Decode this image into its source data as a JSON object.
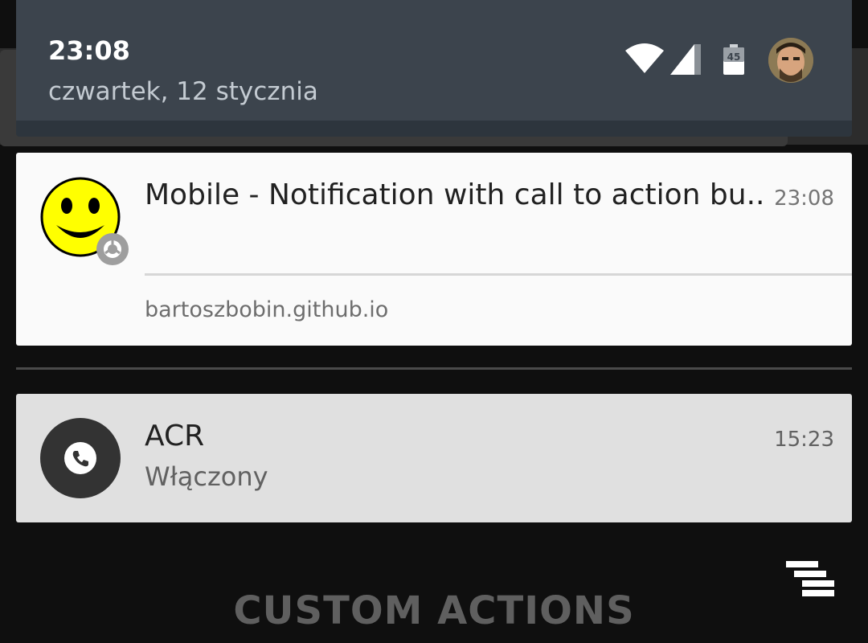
{
  "status_bar": {
    "time": "23:08",
    "date": "czwartek, 12 stycznia",
    "battery_level": "45",
    "icons": [
      "wifi-icon",
      "signal-icon",
      "battery-icon",
      "avatar"
    ]
  },
  "notifications": [
    {
      "title": "Mobile - Notification with call to action bu..",
      "time": "23:08",
      "site": "bartoszbobin.github.io",
      "icon": "smiley-icon",
      "badge_icon": "chrome-badge-icon",
      "background": "#fafafa"
    },
    {
      "title": "ACR",
      "subtitle": "Włączony",
      "time": "15:23",
      "icon": "phone-icon",
      "background": "#e0e0e0"
    }
  ],
  "footer": {
    "custom_actions_label": "CUSTOM ACTIONS",
    "menu_icon": "dismiss-all-icon"
  },
  "colors": {
    "header": "#3c444d",
    "panel_bg": "#0f0f0f",
    "smiley": "#ffff00"
  }
}
